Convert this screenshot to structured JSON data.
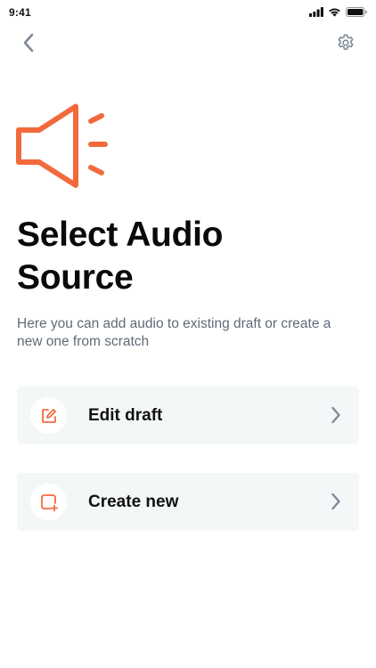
{
  "status_bar": {
    "time": "9:41"
  },
  "icons": {
    "back": "chevron-left-icon",
    "settings": "gear-icon",
    "hero": "speaker-icon",
    "edit": "edit-icon",
    "create": "add-square-icon",
    "chevron": "chevron-right-icon"
  },
  "colors": {
    "accent": "#f26a3c",
    "muted_icon": "#7d8b96",
    "card_background": "#f4f7f8",
    "subtitle": "#5f6b78"
  },
  "header": {
    "title": "Select Audio Source",
    "subtitle": "Here you can add audio to existing draft or create a new one from scratch"
  },
  "options": [
    {
      "label": "Edit draft"
    },
    {
      "label": "Create new"
    }
  ]
}
